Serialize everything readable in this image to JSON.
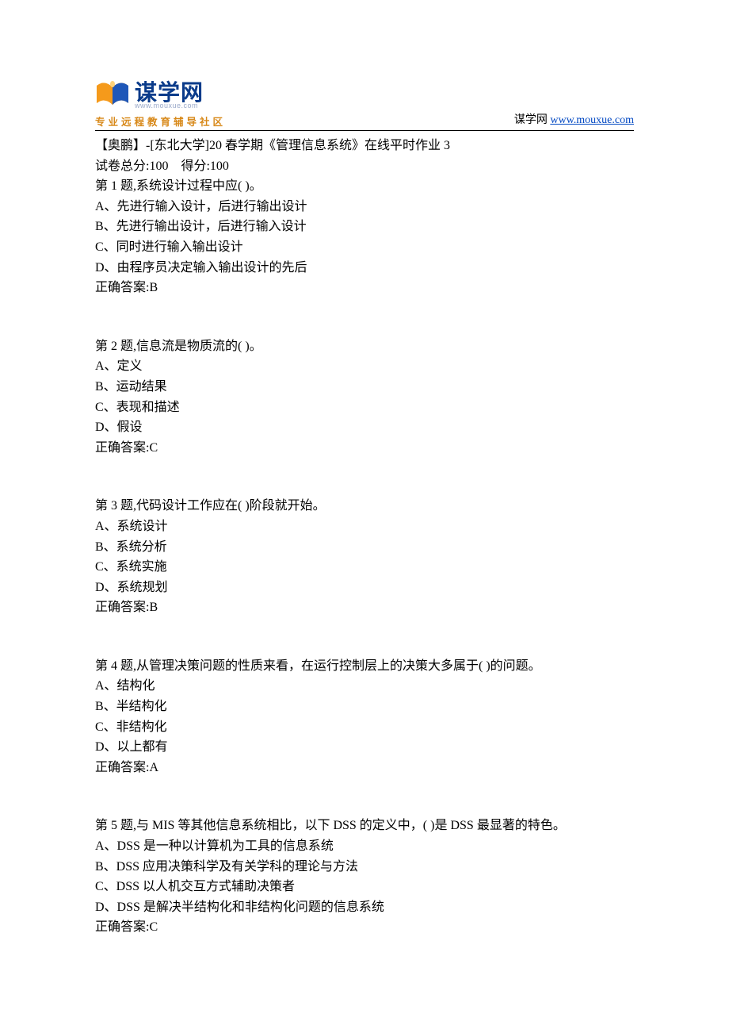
{
  "header": {
    "brand_title": "谋学网",
    "brand_url_small": "www.mouxue.com",
    "tagline": "专业远程教育辅导社区",
    "right_label": "谋学网",
    "right_link_text": "www.mouxue.com"
  },
  "exam": {
    "title": "【奥鹏】-[东北大学]20 春学期《管理信息系统》在线平时作业 3",
    "score_line": "试卷总分:100    得分:100"
  },
  "questions": [
    {
      "stem": "第 1 题,系统设计过程中应( )。",
      "options": [
        "A、先进行输入设计，后进行输出设计",
        "B、先进行输出设计，后进行输入设计",
        "C、同时进行输入输出设计",
        "D、由程序员决定输入输出设计的先后"
      ],
      "answer": "正确答案:B"
    },
    {
      "stem": "第 2 题,信息流是物质流的( )。",
      "options": [
        "A、定义",
        "B、运动结果",
        "C、表现和描述",
        "D、假设"
      ],
      "answer": "正确答案:C"
    },
    {
      "stem": "第 3 题,代码设计工作应在( )阶段就开始。",
      "options": [
        "A、系统设计",
        "B、系统分析",
        "C、系统实施",
        "D、系统规划"
      ],
      "answer": "正确答案:B"
    },
    {
      "stem": "第 4 题,从管理决策问题的性质来看，在运行控制层上的决策大多属于( )的问题。",
      "options": [
        "A、结构化",
        "B、半结构化",
        "C、非结构化",
        "D、以上都有"
      ],
      "answer": "正确答案:A"
    },
    {
      "stem": "第 5 题,与 MIS 等其他信息系统相比，以下 DSS 的定义中，( )是 DSS 最显著的特色。",
      "options": [
        "A、DSS 是一种以计算机为工具的信息系统",
        "B、DSS 应用决策科学及有关学科的理论与方法",
        "C、DSS 以人机交互方式辅助决策者",
        "D、DSS 是解决半结构化和非结构化问题的信息系统"
      ],
      "answer": "正确答案:C"
    }
  ]
}
